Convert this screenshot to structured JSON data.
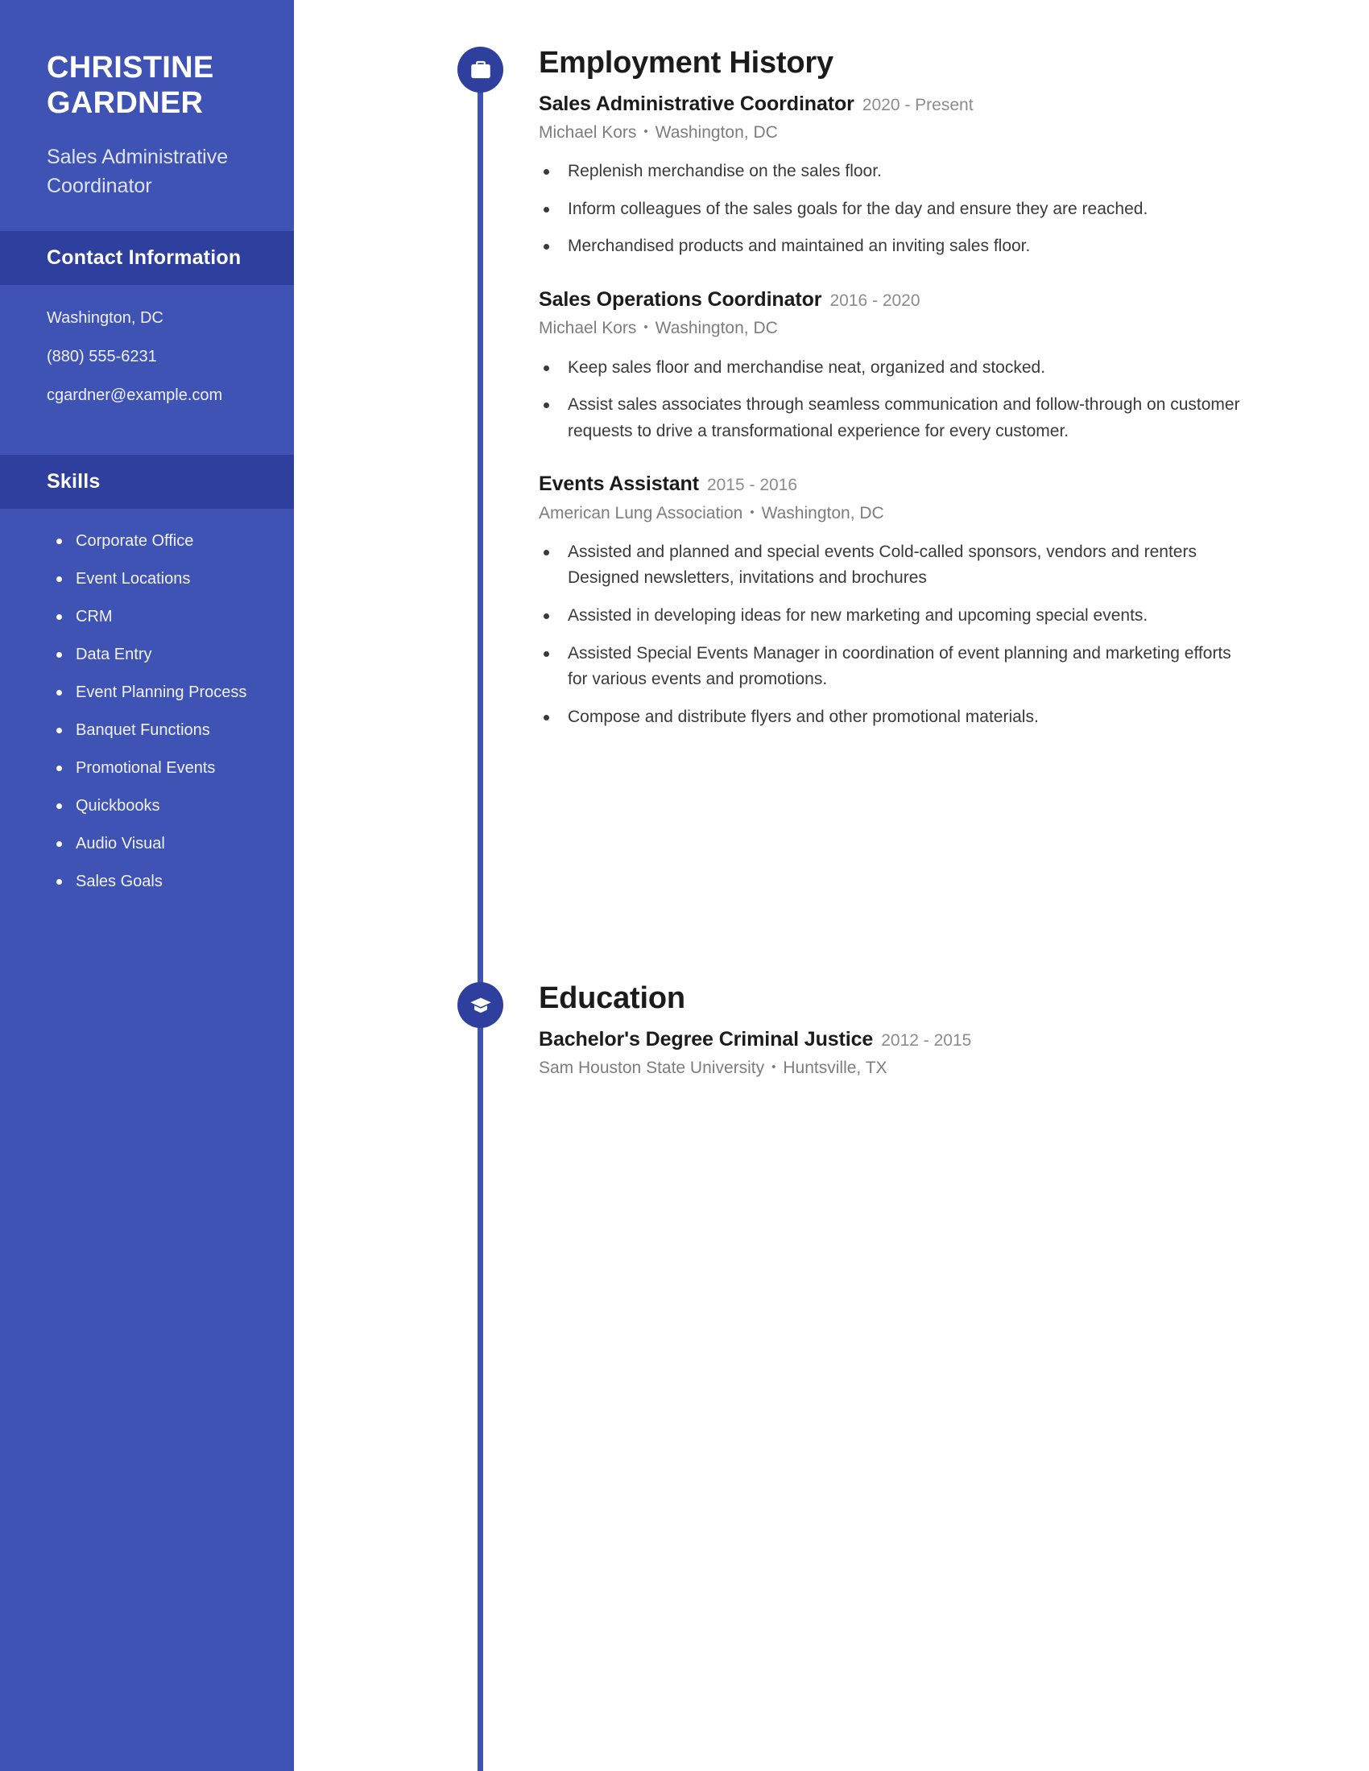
{
  "theme": {
    "sidebar_bg": "#3f53b5",
    "sidebar_band_bg": "#2e3f9e",
    "accent": "#2f3f9e",
    "text_dark": "#1b1b1b",
    "text_muted": "#7d7d7d",
    "page_bg": "#ffffff"
  },
  "sidebar": {
    "name": "CHRISTINE GARDNER",
    "job_title": "Sales Administrative Coordinator",
    "contact": {
      "heading": "Contact Information",
      "items": [
        "Washington, DC",
        "(880) 555-6231",
        "cgardner@example.com"
      ]
    },
    "skills": {
      "heading": "Skills",
      "items": [
        "Corporate Office",
        "Event Locations",
        "CRM",
        "Data Entry",
        "Event Planning Process",
        "Banquet Functions",
        "Promotional Events",
        "Quickbooks",
        "Audio Visual",
        "Sales Goals"
      ]
    }
  },
  "main": {
    "employment": {
      "heading": "Employment History",
      "icon": "briefcase-icon",
      "entries": [
        {
          "title": "Sales Administrative Coordinator",
          "dates": "2020 - Present",
          "company": "Michael Kors",
          "separator": "•",
          "location": "Washington, DC",
          "bullets": [
            "Replenish merchandise on the sales floor.",
            "Inform colleagues of the sales goals for the day and ensure they are reached.",
            "Merchandised products and maintained an inviting sales floor."
          ]
        },
        {
          "title": "Sales Operations Coordinator",
          "dates": "2016 - 2020",
          "company": "Michael Kors",
          "separator": "•",
          "location": "Washington, DC",
          "bullets": [
            "Keep sales floor and merchandise neat, organized and stocked.",
            "Assist sales associates through seamless communication and follow-through on customer requests to drive a transformational experience for every customer."
          ]
        },
        {
          "title": "Events Assistant",
          "dates": "2015 - 2016",
          "company": "American Lung Association",
          "separator": "•",
          "location": "Washington, DC",
          "bullets": [
            "Assisted and planned and special events Cold-called sponsors, vendors and renters Designed newsletters, invitations and brochures",
            "Assisted in developing ideas for new marketing and upcoming special events.",
            "Assisted Special Events Manager in coordination of event planning and marketing efforts for various events and promotions.",
            "Compose and distribute flyers and other promotional materials."
          ]
        }
      ]
    },
    "education": {
      "heading": "Education",
      "icon": "graduation-cap-icon",
      "entries": [
        {
          "title": "Bachelor's Degree Criminal Justice",
          "dates": "2012 - 2015",
          "school": "Sam Houston State University",
          "separator": "•",
          "location": "Huntsville, TX"
        }
      ]
    }
  }
}
